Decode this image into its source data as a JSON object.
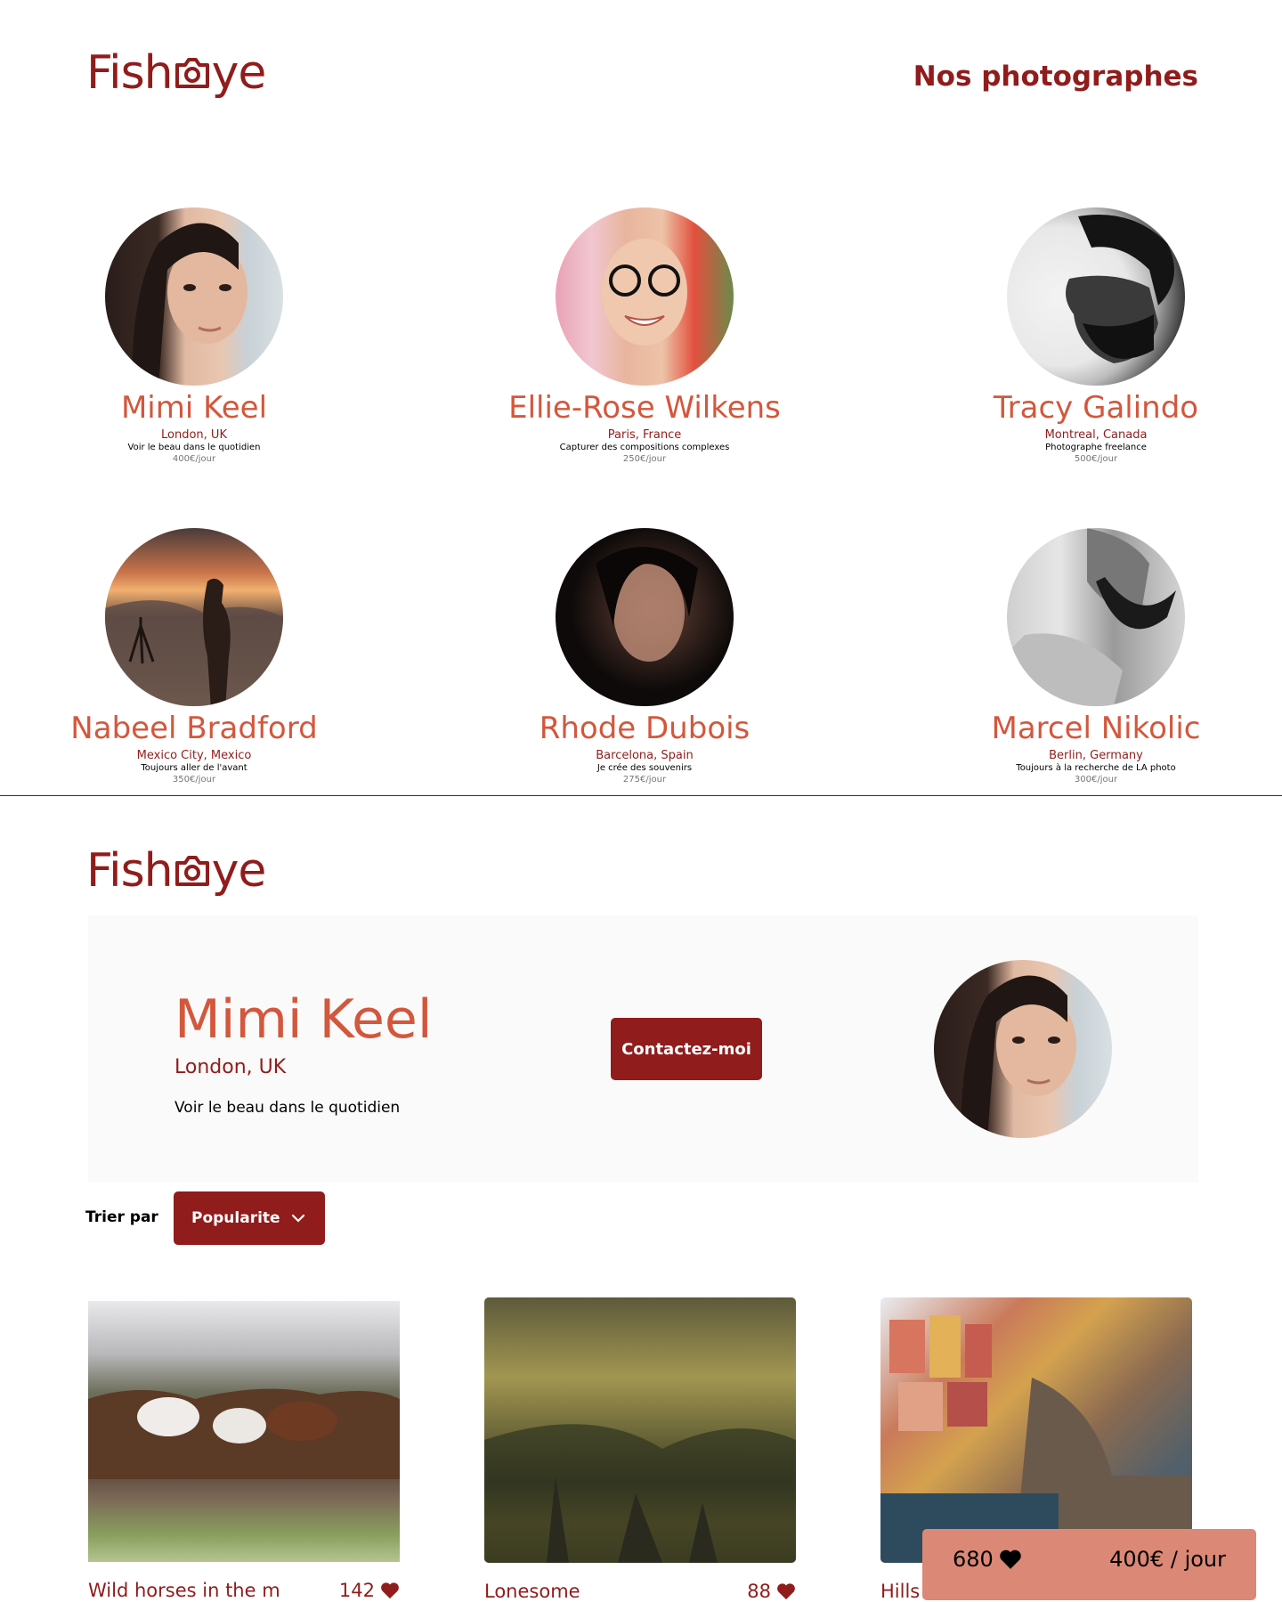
{
  "brand": {
    "logo_left": "Fish",
    "logo_right": "ye"
  },
  "home": {
    "nav_title": "Nos photographes",
    "photographers": [
      {
        "name": "Mimi Keel",
        "location": "London, UK",
        "tagline": "Voir le beau dans le quotidien",
        "price": "400€/jour"
      },
      {
        "name": "Ellie-Rose Wilkens",
        "location": "Paris, France",
        "tagline": "Capturer des compositions complexes",
        "price": "250€/jour"
      },
      {
        "name": "Tracy Galindo",
        "location": "Montreal, Canada",
        "tagline": "Photographe freelance",
        "price": "500€/jour"
      },
      {
        "name": "Nabeel Bradford",
        "location": "Mexico City, Mexico",
        "tagline": "Toujours aller de l'avant",
        "price": "350€/jour"
      },
      {
        "name": "Rhode Dubois",
        "location": "Barcelona, Spain",
        "tagline": "Je crée des souvenirs",
        "price": "275€/jour"
      },
      {
        "name": "Marcel Nikolic",
        "location": "Berlin, Germany",
        "tagline": "Toujours à la recherche de LA photo",
        "price": "300€/jour"
      }
    ]
  },
  "profile": {
    "name": "Mimi Keel",
    "location": "London, UK",
    "tagline": "Voir le beau dans le quotidien",
    "contact_label": "Contactez-moi",
    "sort_label": "Trier par",
    "sort_value": "Popularite",
    "media": [
      {
        "title": "Wild horses in the m",
        "likes": "142"
      },
      {
        "title": "Lonesome",
        "likes": "88"
      },
      {
        "title": "Hills",
        "likes": ""
      }
    ],
    "total_likes": "680",
    "rate": "400€ / jour"
  },
  "colors": {
    "primary": "#901C1C",
    "secondary": "#D3573C",
    "stats_bg": "#DB8876",
    "banner_bg": "#FAFAFA"
  }
}
